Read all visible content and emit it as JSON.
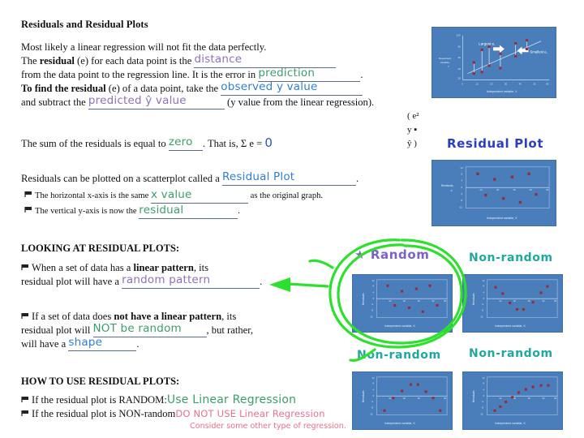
{
  "title": "Residuals and Residual Plots",
  "body": {
    "l1": "Most likely a linear regression will not fit the data perfectly.",
    "l2a": "The ",
    "l2b": "residual",
    "l2c": " (e) for each data point is the ",
    "ans_distance": "distance",
    "l3a": "from the data point to the regression line.  It is the error in ",
    "ans_prediction": "prediction",
    "l3b": ".",
    "l4a": "To find the residual",
    "l4b": " (e) of a data point, take the ",
    "ans_observed": "observed y value",
    "l5a": "and subtract the ",
    "ans_predicted": "predicted  ŷ  value",
    "l5b": "(y value from the linear regression).",
    "formula": "( e²   y ▪ ŷ )",
    "l6a": "The sum of the residuals is equal to ",
    "ans_zero": "zero",
    "l6b": ".  That is, Σ e = ",
    "ans_sigma_zero": "0",
    "l7a": "Residuals can be plotted on a scatterplot called a ",
    "ans_residual_plot": "Residual Plot",
    "l7b": ".",
    "b1a": "The horizontal x-axis is the same ",
    "ans_xvalue": "x value",
    "b1b": "as the original graph.",
    "b2a": "The vertical y-axis is now the ",
    "ans_residual": "residual",
    "b2b": "."
  },
  "section2": {
    "heading": "LOOKING AT RESIDUAL PLOTS:",
    "p1a": "When a set of data has a ",
    "p1b": "linear pattern",
    "p1c": ", its",
    "p2a": "residual plot will have a ",
    "ans_random_pattern": "random pattern",
    "p2b": ".",
    "p3a": "If a set of data does ",
    "p3b": "not have a linear pattern",
    "p3c": ", its",
    "p4a": "residual plot will ",
    "ans_not_be_random": "NOT be random",
    "p4b": ", but rather,",
    "p5a": "will have a ",
    "ans_shape": "shape",
    "p5b": "."
  },
  "section3": {
    "heading": "HOW TO USE RESIDUAL PLOTS:",
    "r1": "If the residual plot is RANDOM:",
    "ans_use_lr": "Use Linear Regression",
    "r2": "If the residual plot is NON-random",
    "ans_donot_use_lr": "DO NOT USE Linear Regression",
    "note": "Consider some other type of regression."
  },
  "figures": {
    "scatter_top": {
      "ylabel": "Dependent variable, Y",
      "xlabel": "Independent variable, X",
      "ann_largest": "Largest e,",
      "ann_smallest": "Smallest e,"
    },
    "residual_plot_label": "Residual Plot",
    "residual_plot": {
      "ylabel": "Residuals, e",
      "xlabel": "Independent variable, X"
    },
    "random_label": "★ Random",
    "random": {
      "ylabel": "Residuals",
      "xlabel": "Independent variable, X"
    },
    "nonrandom1_label": "Non-random",
    "nonrandom1": {
      "ylabel": "Residuals",
      "xlabel": "Independent variable, X"
    },
    "nonrandom2_label": "Non-random",
    "nonrandom2": {
      "ylabel": "Residuals",
      "xlabel": "Independent variable, X"
    },
    "nonrandom3_label": "Non-random",
    "nonrandom3": {
      "ylabel": "Residuals",
      "xlabel": "Independent variable, X"
    }
  },
  "chart_data": [
    {
      "id": "scatter_top",
      "type": "scatter",
      "title": "",
      "xlabel": "Independent variable, X",
      "ylabel": "Dependent variable, Y",
      "xlim": [
        0,
        60
      ],
      "ylim": [
        0,
        100
      ],
      "xticks": [
        0,
        10,
        20,
        30,
        40,
        50,
        60
      ],
      "yticks": [
        0,
        20,
        40,
        60,
        80,
        100
      ],
      "grid": false,
      "annotations": [
        "Largest e,",
        "Smallest e,"
      ],
      "points": [
        {
          "x": 8,
          "y": 52
        },
        {
          "x": 8,
          "y": 36
        },
        {
          "x": 13,
          "y": 67
        },
        {
          "x": 13,
          "y": 25
        },
        {
          "x": 18,
          "y": 74
        },
        {
          "x": 20,
          "y": 46
        },
        {
          "x": 26,
          "y": 62
        },
        {
          "x": 27,
          "y": 40
        },
        {
          "x": 34,
          "y": 80
        },
        {
          "x": 35,
          "y": 60
        },
        {
          "x": 41,
          "y": 88
        },
        {
          "x": 41,
          "y": 72
        }
      ],
      "regression_line": {
        "x0": 4,
        "y0": 30,
        "x1": 46,
        "y1": 82
      }
    },
    {
      "id": "residual_plot",
      "type": "scatter",
      "title": "Residual Plot",
      "xlabel": "Independent variable, X",
      "ylabel": "Residuals, e",
      "xlim": [
        0,
        50
      ],
      "ylim": [
        -12,
        12
      ],
      "xticks": [
        10,
        20,
        30,
        40,
        50
      ],
      "yticks": [
        12,
        8,
        4,
        0,
        -4,
        -8,
        -12
      ],
      "grid": false,
      "points": [
        {
          "x": 7,
          "y": 8
        },
        {
          "x": 11,
          "y": -5
        },
        {
          "x": 16,
          "y": 5
        },
        {
          "x": 20,
          "y": -6
        },
        {
          "x": 25,
          "y": 6
        },
        {
          "x": 30,
          "y": -8
        },
        {
          "x": 35,
          "y": 8
        },
        {
          "x": 40,
          "y": -4
        }
      ]
    },
    {
      "id": "random",
      "type": "scatter",
      "title": "★ Random",
      "xlabel": "Independent variable, X",
      "ylabel": "Residuals",
      "xlim": [
        0,
        50
      ],
      "ylim": [
        -12,
        12
      ],
      "xticks": [
        10,
        20,
        30,
        40,
        50
      ],
      "yticks": [
        12,
        8,
        4,
        0,
        -4,
        -8,
        -12
      ],
      "grid": false,
      "points": [
        {
          "x": 7,
          "y": 8
        },
        {
          "x": 11,
          "y": -5
        },
        {
          "x": 16,
          "y": 5
        },
        {
          "x": 20,
          "y": -6
        },
        {
          "x": 25,
          "y": 6
        },
        {
          "x": 30,
          "y": -8
        },
        {
          "x": 35,
          "y": 8
        },
        {
          "x": 40,
          "y": -4
        }
      ]
    },
    {
      "id": "nonrandom1",
      "type": "scatter",
      "title": "Non-random",
      "xlabel": "Independent variable, X",
      "ylabel": "Residuals",
      "xlim": [
        0,
        50
      ],
      "ylim": [
        -12,
        12
      ],
      "xticks": [
        10,
        20,
        30,
        40,
        50
      ],
      "yticks": [
        12,
        8,
        4,
        0,
        -4,
        -8,
        -12
      ],
      "grid": false,
      "points": [
        {
          "x": 6,
          "y": 8
        },
        {
          "x": 10,
          "y": 4
        },
        {
          "x": 14,
          "y": -2
        },
        {
          "x": 19,
          "y": -3
        },
        {
          "x": 23,
          "y": -6
        },
        {
          "x": 27,
          "y": -6
        },
        {
          "x": 33,
          "y": 4
        },
        {
          "x": 39,
          "y": 8
        }
      ]
    },
    {
      "id": "nonrandom2",
      "type": "scatter",
      "title": "Non-random",
      "xlabel": "Independent variable, X",
      "ylabel": "Residuals",
      "xlim": [
        0,
        50
      ],
      "ylim": [
        -12,
        12
      ],
      "xticks": [
        10,
        20,
        30,
        40,
        50
      ],
      "yticks": [
        12,
        8,
        4,
        0,
        -4,
        -8,
        -12
      ],
      "grid": false,
      "points": [
        {
          "x": 5,
          "y": -9
        },
        {
          "x": 10,
          "y": -1
        },
        {
          "x": 15,
          "y": 4
        },
        {
          "x": 20,
          "y": 8
        },
        {
          "x": 24,
          "y": 8
        },
        {
          "x": 29,
          "y": 4
        },
        {
          "x": 34,
          "y": -1
        },
        {
          "x": 39,
          "y": -9
        }
      ]
    },
    {
      "id": "nonrandom3",
      "type": "scatter",
      "title": "Non-random",
      "xlabel": "Independent variable, X",
      "ylabel": "Residuals",
      "xlim": [
        0,
        50
      ],
      "ylim": [
        -12,
        12
      ],
      "xticks": [
        10,
        20,
        30,
        40,
        50
      ],
      "yticks": [
        12,
        8,
        4,
        0,
        -4,
        -8,
        -12
      ],
      "grid": false,
      "points": [
        {
          "x": 5,
          "y": -9
        },
        {
          "x": 9,
          "y": -7
        },
        {
          "x": 13,
          "y": -4
        },
        {
          "x": 17,
          "y": -1
        },
        {
          "x": 21,
          "y": 2
        },
        {
          "x": 25,
          "y": 4
        },
        {
          "x": 29,
          "y": 5
        },
        {
          "x": 34,
          "y": 6
        },
        {
          "x": 39,
          "y": 6
        }
      ]
    }
  ],
  "colors": {
    "purple": "#8d72b8",
    "green": "#3d9d6d",
    "blue": "#2f7fd0",
    "dark_blue": "#2b3fc0",
    "teal": "#1fa8a0",
    "pink": "#e8718e",
    "annotation_green": "#2ee02e",
    "chart_bg": "#4a7ebb",
    "chart_point": "#9c2b35"
  }
}
